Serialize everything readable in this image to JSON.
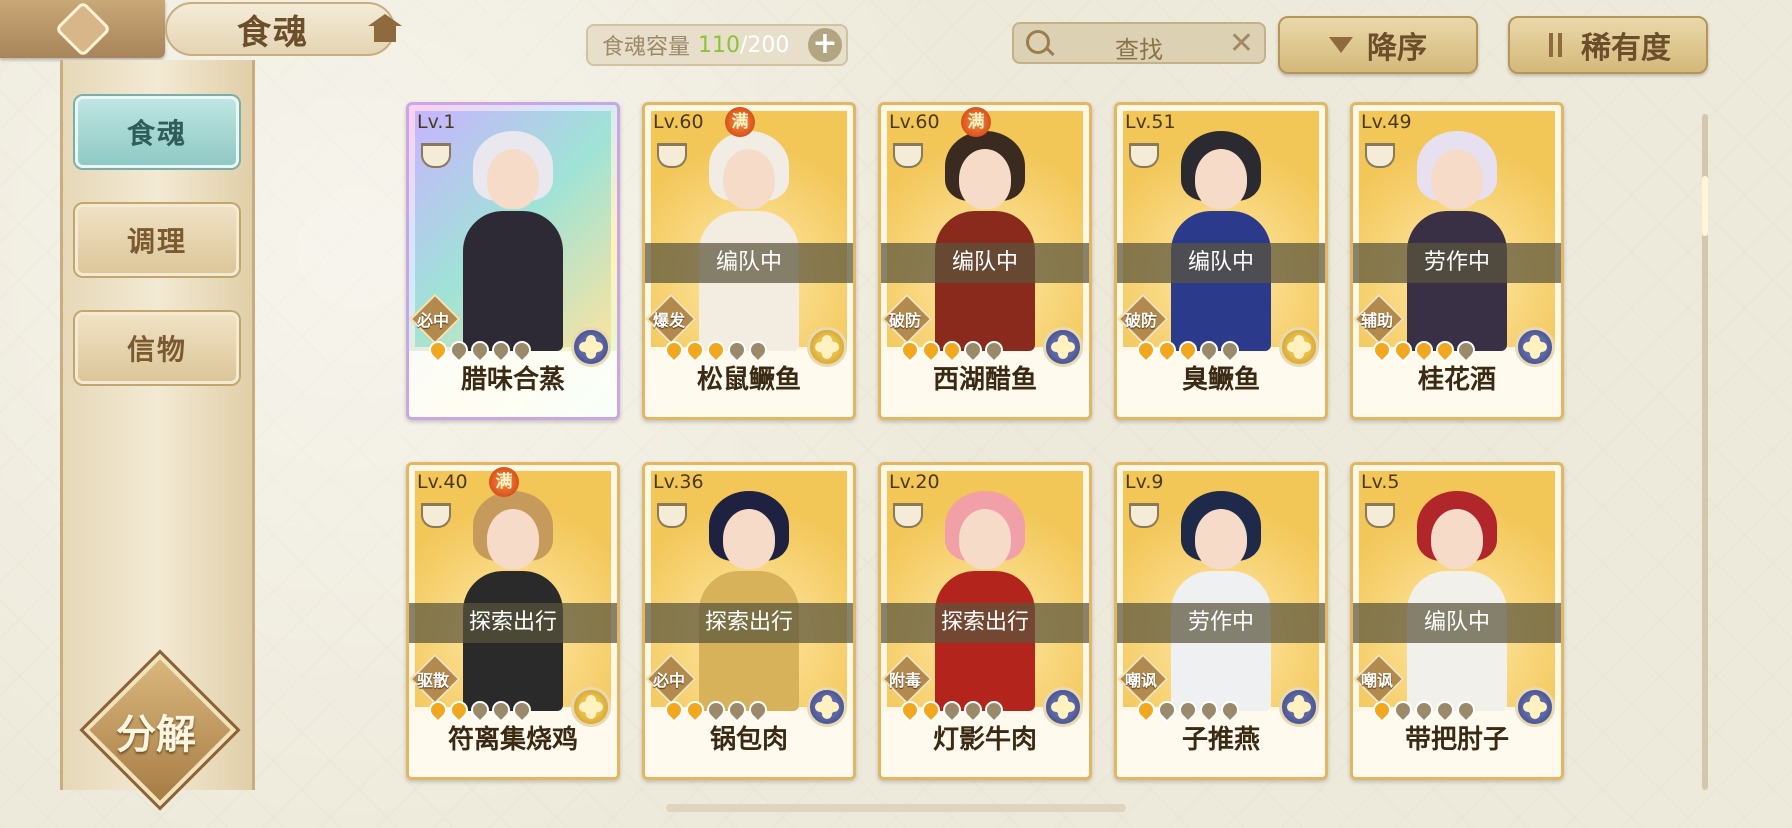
{
  "header": {
    "title": "食魂",
    "capacity_label": "食魂容量",
    "capacity_current": "110",
    "capacity_max": "/200",
    "search_placeholder": "查找",
    "sort_label": "降序",
    "rarity_label": "稀有度"
  },
  "sidebar": {
    "tabs": [
      {
        "label": "食魂",
        "active": true
      },
      {
        "label": "调理",
        "active": false
      },
      {
        "label": "信物",
        "active": false
      }
    ],
    "decompose_label": "分解"
  },
  "cards": [
    {
      "level": "Lv.1",
      "max": "",
      "status": "",
      "role": "必中",
      "name": "腊味合蒸",
      "stars_on": 1,
      "stars_total": 5,
      "element": "blue",
      "rainbow": true,
      "hair": "#e8e8ee",
      "outfit": "#2d2a36"
    },
    {
      "level": "Lv.60",
      "max": "满",
      "status": "编队中",
      "role": "爆发",
      "name": "松鼠鳜鱼",
      "stars_on": 3,
      "stars_total": 5,
      "element": "gold",
      "rainbow": false,
      "hair": "#f1ede4",
      "outfit": "#f3ece0"
    },
    {
      "level": "Lv.60",
      "max": "满",
      "status": "编队中",
      "role": "破防",
      "name": "西湖醋鱼",
      "stars_on": 3,
      "stars_total": 5,
      "element": "blue",
      "rainbow": false,
      "hair": "#3a2a20",
      "outfit": "#8a2a1c"
    },
    {
      "level": "Lv.51",
      "max": "",
      "status": "编队中",
      "role": "破防",
      "name": "臭鳜鱼",
      "stars_on": 3,
      "stars_total": 5,
      "element": "gold",
      "rainbow": false,
      "hair": "#2a2a30",
      "outfit": "#2c3a8c"
    },
    {
      "level": "Lv.49",
      "max": "",
      "status": "劳作中",
      "role": "辅助",
      "name": "桂花酒",
      "stars_on": 4,
      "stars_total": 5,
      "element": "blue",
      "rainbow": false,
      "hair": "#e6e0f0",
      "outfit": "#3a3046"
    },
    {
      "level": "Lv.40",
      "max": "满",
      "status": "探索出行",
      "role": "驱散",
      "name": "符离集烧鸡",
      "stars_on": 2,
      "stars_total": 5,
      "element": "gold",
      "rainbow": false,
      "hair": "#c69a5a",
      "outfit": "#2a2a2a"
    },
    {
      "level": "Lv.36",
      "max": "",
      "status": "探索出行",
      "role": "必中",
      "name": "锅包肉",
      "stars_on": 2,
      "stars_total": 5,
      "element": "blue",
      "rainbow": false,
      "hair": "#1e2240",
      "outfit": "#d8b25a"
    },
    {
      "level": "Lv.20",
      "max": "",
      "status": "探索出行",
      "role": "附毒",
      "name": "灯影牛肉",
      "stars_on": 2,
      "stars_total": 5,
      "element": "blue",
      "rainbow": false,
      "hair": "#f0a0a6",
      "outfit": "#b2241c"
    },
    {
      "level": "Lv.9",
      "max": "",
      "status": "劳作中",
      "role": "嘲讽",
      "name": "子推燕",
      "stars_on": 1,
      "stars_total": 5,
      "element": "blue",
      "rainbow": false,
      "hair": "#1f2a4a",
      "outfit": "#eef0f2"
    },
    {
      "level": "Lv.5",
      "max": "",
      "status": "编队中",
      "role": "嘲讽",
      "name": "带把肘子",
      "stars_on": 1,
      "stars_total": 5,
      "element": "blue",
      "rainbow": false,
      "hair": "#b0262a",
      "outfit": "#f2f0ea"
    }
  ]
}
